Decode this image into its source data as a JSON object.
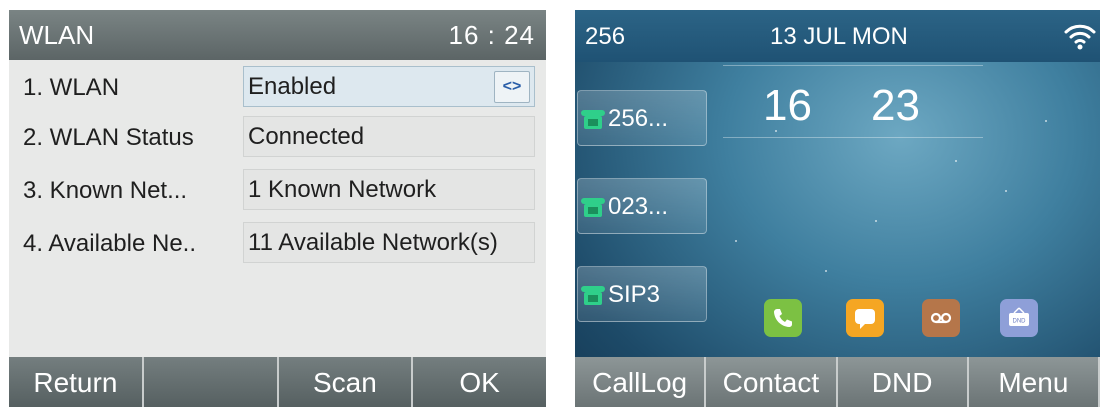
{
  "wlan_screen": {
    "title": "WLAN",
    "time": "16 : 24",
    "rows": [
      {
        "label": "1.  WLAN",
        "value": "Enabled"
      },
      {
        "label": "2.  WLAN Status",
        "value": "Connected"
      },
      {
        "label": "3.  Known Net...",
        "value": "1 Known Network"
      },
      {
        "label": "4.  Available Ne..",
        "value": "11 Available Network(s)"
      }
    ],
    "switch_symbol": "<>",
    "softkeys": [
      "Return",
      "",
      "Scan",
      "OK"
    ]
  },
  "idle_screen": {
    "extension": "256",
    "date": "13 JUL MON",
    "clock": {
      "hours": "16",
      "minutes": "23"
    },
    "line_keys": [
      "256...",
      "023...",
      "SIP3"
    ],
    "app_icons": [
      {
        "name": "phone-app-icon",
        "color": "#7cc143"
      },
      {
        "name": "message-app-icon",
        "color": "#f5a623"
      },
      {
        "name": "voicemail-app-icon",
        "color": "#b5764a"
      },
      {
        "name": "dnd-app-icon",
        "color": "#8e9fd8",
        "text": "DND"
      }
    ],
    "softkeys": [
      "CallLog",
      "Contact",
      "DND",
      "Menu"
    ]
  },
  "colors": {
    "line_key_phone_icon": "#2fcf8a",
    "switch_arrows": "#2a5ea8"
  }
}
